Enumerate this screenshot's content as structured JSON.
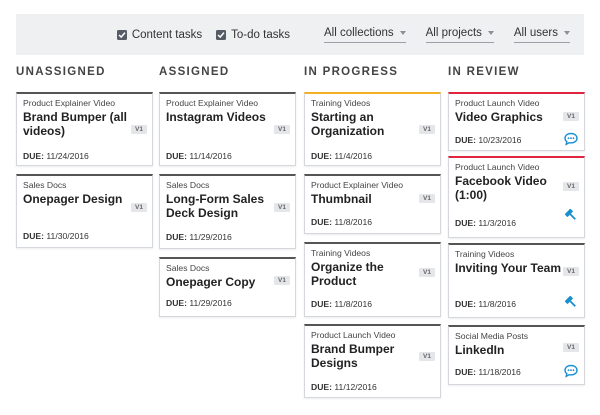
{
  "filters": {
    "content_tasks": "Content tasks",
    "todo_tasks": "To-do tasks",
    "collections": "All collections",
    "projects": "All projects",
    "users": "All users"
  },
  "colors": {
    "accent_yellow": "#f2b124",
    "accent_red": "#e0253f",
    "icon_blue": "#1a8fd0"
  },
  "columns": [
    {
      "title": "UNASSIGNED",
      "cards": [
        {
          "category": "Product Explainer Video",
          "title": "Brand Bumper (all videos)",
          "due_label": "DUE:",
          "due": "11/24/2016",
          "version": "V1"
        },
        {
          "category": "Sales Docs",
          "title": "Onepager Design",
          "due_label": "DUE:",
          "due": "11/30/2016",
          "version": "V1"
        }
      ]
    },
    {
      "title": "ASSIGNED",
      "cards": [
        {
          "category": "Product Explainer Video",
          "title": "Instagram Videos",
          "due_label": "DUE:",
          "due": "11/14/2016",
          "version": "V1"
        },
        {
          "category": "Sales Docs",
          "title": "Long-Form Sales Deck Design",
          "due_label": "DUE:",
          "due": "11/29/2016",
          "version": "V1"
        },
        {
          "category": "Sales Docs",
          "title": "Onepager Copy",
          "due_label": "DUE:",
          "due": "11/29/2016",
          "version": "V1"
        }
      ]
    },
    {
      "title": "IN PROGRESS",
      "cards": [
        {
          "category": "Training Videos",
          "title": "Starting an Organization",
          "due_label": "DUE:",
          "due": "11/4/2016",
          "version": "V1"
        },
        {
          "category": "Product Explainer Video",
          "title": "Thumbnail",
          "due_label": "DUE:",
          "due": "11/8/2016",
          "version": "V1"
        },
        {
          "category": "Training Videos",
          "title": "Organize the Product",
          "due_label": "DUE:",
          "due": "11/8/2016",
          "version": "V1"
        },
        {
          "category": "Product Launch Video",
          "title": "Brand Bumper Designs",
          "due_label": "DUE:",
          "due": "11/12/2016",
          "version": "V1"
        }
      ]
    },
    {
      "title": "IN REVIEW",
      "cards": [
        {
          "category": "Product Launch Video",
          "title": "Video Graphics",
          "due_label": "DUE:",
          "due": "10/23/2016",
          "version": "V1",
          "icon": "comment-icon"
        },
        {
          "category": "Product Launch Video",
          "title": "Facebook Video (1:00)",
          "due_label": "DUE:",
          "due": "11/3/2016",
          "version": "V1",
          "icon": "gavel-icon"
        },
        {
          "category": "Training Videos",
          "title": "Inviting Your Team",
          "due_label": "DUE:",
          "due": "11/8/2016",
          "version": "V1",
          "icon": "gavel-icon"
        },
        {
          "category": "Social Media Posts",
          "title": "LinkedIn",
          "due_label": "DUE:",
          "due": "11/18/2016",
          "version": "V1",
          "icon": "comment-icon"
        }
      ]
    }
  ]
}
